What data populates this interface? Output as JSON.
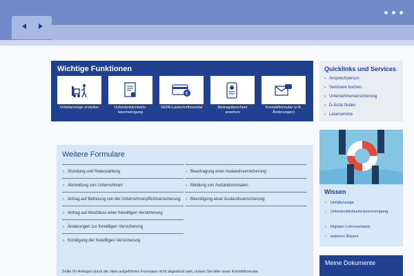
{
  "browser": {
    "back_icon": "triangle-left-icon",
    "forward_icon": "triangle-right-icon"
  },
  "wichtige_funktionen": {
    "title": "Wichtige Funktionen",
    "tiles": [
      {
        "label": "Unfallanzeige erstellen",
        "icon": "forklift-worker-icon"
      },
      {
        "label": "Unbedenklichkeits-bescheinigung",
        "icon": "certificate-icon"
      },
      {
        "label": "SEPA-Lastschriftmandat",
        "icon": "credit-card-euro-icon"
      },
      {
        "label": "Beitragsbescheid ansehen",
        "icon": "document-phone-icon"
      },
      {
        "label": "Kontaktformular (z.B. Änderungen)",
        "icon": "envelope-chat-icon"
      }
    ]
  },
  "weitere_formulare": {
    "title": "Weitere Formulare",
    "left": [
      "Stundung und Ratenzahlung",
      "Abmeldung von Unternehmen",
      "Antrag auf Befreiung von der Unternehmerpflichtversicherung",
      "Antrag auf Abschluss einer freiwilligen Versicherung",
      "Änderungen zur freiwilligen Versicherung",
      "Kündigung der freiwilligen Versicherung"
    ],
    "right": [
      "Beantragung einer Auslandsversicherung",
      "Meldung von Auslandsmonaten",
      "Beendigung einer Auslandsversicherung"
    ],
    "note": "Sollte Ihr Anliegen durch die oben aufgeführten Formulare nicht abgedeckt sein, nutzen Sie bitte unser Kontaktformular."
  },
  "quicklinks": {
    "title": "Quicklinks und Services",
    "items": [
      "Ansprechperson",
      "Seminare buchen",
      "Unternehmerversicherung",
      "D-Ärzte finden",
      "Leserservice"
    ]
  },
  "wissen": {
    "title": "Wissen",
    "image_icon": "lifebuoy-hands-icon",
    "items": [
      "Unfallanzeige",
      "Unbedenklichkeits-bescheinigung",
      "Digitaler Lohnnachweis",
      "weiteres Wissen"
    ]
  },
  "meine_dokumente": {
    "title": "Meine Dokumente"
  },
  "colors": {
    "brand_blue": "#1f3f8f",
    "chrome_blue": "#7289c7",
    "light_blue": "#d6e7f8"
  }
}
